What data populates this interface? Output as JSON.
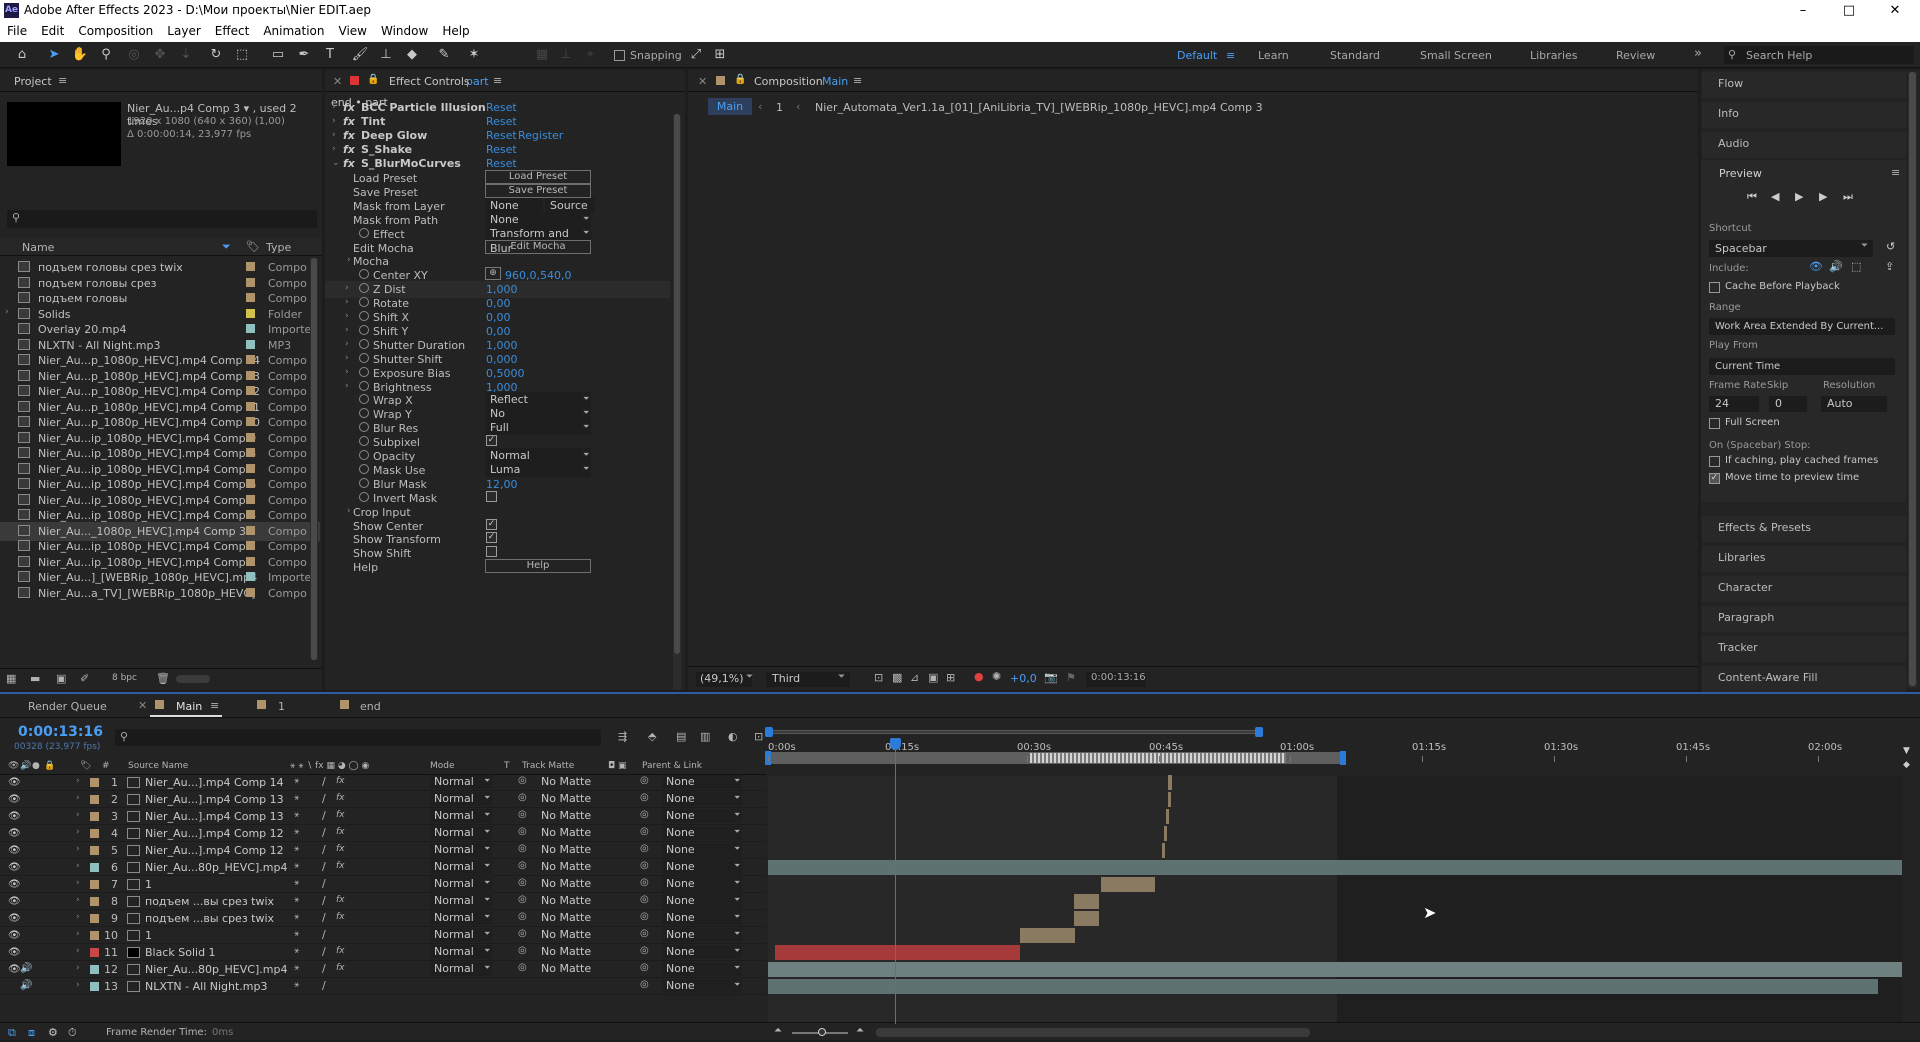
{
  "title_bar": {
    "app_icon": "Ae",
    "title": "Adobe After Effects 2023 - D:\\Мои проекты\\Nier EDIT.aep",
    "min": "–",
    "max": "□",
    "close": "✕"
  },
  "menu": [
    "File",
    "Edit",
    "Composition",
    "Layer",
    "Effect",
    "Animation",
    "View",
    "Window",
    "Help"
  ],
  "toolbar": {
    "snapping_label": "Snapping",
    "workspaces": [
      "Default",
      "Learn",
      "Standard",
      "Small Screen",
      "Libraries",
      "Review"
    ],
    "more": "»",
    "search_placeholder": "Search Help"
  },
  "project": {
    "tab": "Project",
    "preview": {
      "name": "Nier_Au...p4 Comp 3 ▾ , used 2 times",
      "dims": "1920 x 1080  (640 x 360) (1,00)",
      "duration": "Δ 0:00:00:14, 23,977 fps"
    },
    "search_placeholder": "",
    "col_name": "Name",
    "col_type": "Type",
    "items": [
      {
        "name": "подъем головы срез twix",
        "type": "Compo",
        "color": "#b0936b"
      },
      {
        "name": "подъем головы срез",
        "type": "Compo",
        "color": "#b0936b"
      },
      {
        "name": "подъем головы",
        "type": "Compo",
        "color": "#b0936b"
      },
      {
        "name": "Solids",
        "type": "Folder",
        "color": "#d2c24b"
      },
      {
        "name": "Overlay 20.mp4",
        "type": "Importe",
        "color": "#8fbfbf"
      },
      {
        "name": "NLXTN - All Night.mp3",
        "type": "MP3",
        "color": "#8fbfbf"
      },
      {
        "name": "Nier_Au...p_1080p_HEVC].mp4 Comp 14",
        "type": "Compo",
        "color": "#b0936b"
      },
      {
        "name": "Nier_Au...p_1080p_HEVC].mp4 Comp 13",
        "type": "Compo",
        "color": "#b0936b"
      },
      {
        "name": "Nier_Au...p_1080p_HEVC].mp4 Comp 12",
        "type": "Compo",
        "color": "#b0936b"
      },
      {
        "name": "Nier_Au...p_1080p_HEVC].mp4 Comp 11",
        "type": "Compo",
        "color": "#b0936b"
      },
      {
        "name": "Nier_Au...p_1080p_HEVC].mp4 Comp 10",
        "type": "Compo",
        "color": "#b0936b"
      },
      {
        "name": "Nier_Au...ip_1080p_HEVC].mp4 Comp 9",
        "type": "Compo",
        "color": "#b0936b"
      },
      {
        "name": "Nier_Au...ip_1080p_HEVC].mp4 Comp 8",
        "type": "Compo",
        "color": "#b0936b"
      },
      {
        "name": "Nier_Au...ip_1080p_HEVC].mp4 Comp 7",
        "type": "Compo",
        "color": "#b0936b"
      },
      {
        "name": "Nier_Au...ip_1080p_HEVC].mp4 Comp 6",
        "type": "Compo",
        "color": "#b0936b"
      },
      {
        "name": "Nier_Au...ip_1080p_HEVC].mp4 Comp 5",
        "type": "Compo",
        "color": "#b0936b"
      },
      {
        "name": "Nier_Au...ip_1080p_HEVC].mp4 Comp 4",
        "type": "Compo",
        "color": "#b0936b"
      },
      {
        "name": "Nier_Au..._1080p_HEVC].mp4 Comp 3",
        "type": "Compo",
        "color": "#b0936b"
      },
      {
        "name": "Nier_Au...ip_1080p_HEVC].mp4 Comp 2",
        "type": "Compo",
        "color": "#b0936b"
      },
      {
        "name": "Nier_Au...ip_1080p_HEVC].mp4 Comp 1",
        "type": "Compo",
        "color": "#b0936b"
      },
      {
        "name": "Nier_Au...]_[WEBRip_1080p_HEVC].mp4",
        "type": "Importe",
        "color": "#8fbfbf"
      },
      {
        "name": "Nier_Au...a_TV]_[WEBRip_1080p_HEVC]",
        "type": "Compo",
        "color": "#b0936b"
      }
    ],
    "bpc": "8 bpc"
  },
  "effect_controls": {
    "tab": "Effect Controls",
    "tab_layer": "part",
    "breadcrumb": "end • part",
    "effects": [
      {
        "name": "BCC Particle Illusion",
        "reset": "Reset",
        "extra": ""
      },
      {
        "name": "Tint",
        "reset": "Reset",
        "extra": ""
      },
      {
        "name": "Deep Glow",
        "reset": "Reset",
        "extra": "Register"
      },
      {
        "name": "S_Shake",
        "reset": "Reset",
        "extra": ""
      },
      {
        "name": "S_BlurMoCurves",
        "reset": "Reset",
        "extra": ""
      }
    ],
    "params": [
      {
        "label": "Load Preset",
        "kind": "btn",
        "value": "Load Preset"
      },
      {
        "label": "Save Preset",
        "kind": "btn",
        "value": "Save Preset"
      },
      {
        "label": "Mask from Layer",
        "kind": "dd2",
        "value": "None",
        "value2": "Source"
      },
      {
        "label": "Mask from Path",
        "kind": "dd",
        "value": "None"
      },
      {
        "label": "Effect",
        "kind": "dd",
        "value": "Transform and Blur"
      },
      {
        "label": "Edit Mocha",
        "kind": "btn",
        "value": "Edit Mocha"
      },
      {
        "label": "Mocha",
        "kind": "group",
        "value": ""
      },
      {
        "label": "Center XY",
        "kind": "val",
        "value": "960,0,540,0"
      },
      {
        "label": "Z Dist",
        "kind": "val",
        "value": "1,000"
      },
      {
        "label": "Rotate",
        "kind": "val",
        "value": "0,00"
      },
      {
        "label": "Shift X",
        "kind": "val",
        "value": "0,00"
      },
      {
        "label": "Shift Y",
        "kind": "val",
        "value": "0,00"
      },
      {
        "label": "Shutter Duration",
        "kind": "val",
        "value": "1,000"
      },
      {
        "label": "Shutter Shift",
        "kind": "val",
        "value": "0,000"
      },
      {
        "label": "Exposure Bias",
        "kind": "val",
        "value": "0,5000"
      },
      {
        "label": "Brightness",
        "kind": "val",
        "value": "1,000"
      },
      {
        "label": "Wrap X",
        "kind": "dd",
        "value": "Reflect"
      },
      {
        "label": "Wrap Y",
        "kind": "dd",
        "value": "No"
      },
      {
        "label": "Blur Res",
        "kind": "dd",
        "value": "Full"
      },
      {
        "label": "Subpixel",
        "kind": "chk",
        "value": "✓"
      },
      {
        "label": "Opacity",
        "kind": "dd",
        "value": "Normal"
      },
      {
        "label": "Mask Use",
        "kind": "dd",
        "value": "Luma"
      },
      {
        "label": "Blur Mask",
        "kind": "val",
        "value": "12,00"
      },
      {
        "label": "Invert Mask",
        "kind": "chk",
        "value": ""
      },
      {
        "label": "Crop Input",
        "kind": "group",
        "value": ""
      },
      {
        "label": "Show Center",
        "kind": "chk",
        "value": "✓"
      },
      {
        "label": "Show Transform",
        "kind": "chk",
        "value": "✓"
      },
      {
        "label": "Show Shift",
        "kind": "chk",
        "value": ""
      },
      {
        "label": "Help",
        "kind": "btn",
        "value": "Help"
      }
    ]
  },
  "composition": {
    "tab": "Composition",
    "tab_name": "Main",
    "crumb_main": "Main",
    "crumb_num": "1",
    "crumb_path": "Nier_Automata_Ver1.1a_[01]_[AniLibria_TV]_[WEBRip_1080p_HEVC].mp4 Comp 3",
    "zoom": "(49,1%)",
    "resolution": "Third",
    "exposure": "+0,0",
    "timecode": "0:00:13:16"
  },
  "right_panel": {
    "items_top": [
      "Flow",
      "Info",
      "Audio"
    ],
    "preview_title": "Preview",
    "shortcut_label": "Shortcut",
    "shortcut_value": "Spacebar",
    "include_label": "Include:",
    "cache_label": "Cache Before Playback",
    "range_label": "Range",
    "range_value": "Work Area Extended By Current...",
    "play_from_label": "Play From",
    "play_from_value": "Current Time",
    "frame_rate_label": "Frame Rate",
    "skip_label": "Skip",
    "resolution_label": "Resolution",
    "frame_rate_value": "24",
    "skip_value": "0",
    "resolution_value": "Auto",
    "full_screen_label": "Full Screen",
    "stop_label": "On (Spacebar) Stop:",
    "if_caching_label": "If caching, play cached frames",
    "move_time_label": "Move time to preview time",
    "items_bottom": [
      "Effects & Presets",
      "Libraries",
      "Character",
      "Paragraph",
      "Tracker",
      "Content-Aware Fill"
    ]
  },
  "timeline": {
    "tab_render": "Render Queue",
    "tab_main": "Main",
    "tab_1": "1",
    "tab_end": "end",
    "timecode": "0:00:13:16",
    "frames": "00328 (23,977 fps)",
    "col_source": "Source Name",
    "col_mode": "Mode",
    "col_t": "T",
    "col_matte": "Track Matte",
    "col_parent": "Parent & Link",
    "ticks": [
      "0:00s",
      "00:15s",
      "00:30s",
      "00:45s",
      "01:00s",
      "01:15s",
      "01:30s",
      "01:45s",
      "02:00s"
    ],
    "layers": [
      {
        "num": "1",
        "name": "Nier_Au...].mp4 Comp 14",
        "mode": "Normal",
        "matte": "No Matte",
        "parent": "None",
        "color": "#b0936b"
      },
      {
        "num": "2",
        "name": "Nier_Au...].mp4 Comp 13",
        "mode": "Normal",
        "matte": "No Matte",
        "parent": "None",
        "color": "#b0936b"
      },
      {
        "num": "3",
        "name": "Nier_Au...].mp4 Comp 13",
        "mode": "Normal",
        "matte": "No Matte",
        "parent": "None",
        "color": "#b0936b"
      },
      {
        "num": "4",
        "name": "Nier_Au...].mp4 Comp 12",
        "mode": "Normal",
        "matte": "No Matte",
        "parent": "None",
        "color": "#b0936b"
      },
      {
        "num": "5",
        "name": "Nier_Au...].mp4 Comp 12",
        "mode": "Normal",
        "matte": "No Matte",
        "parent": "None",
        "color": "#b0936b"
      },
      {
        "num": "6",
        "name": "Nier_Au...80p_HEVC].mp4",
        "mode": "Normal",
        "matte": "No Matte",
        "parent": "None",
        "color": "#8fbfbf"
      },
      {
        "num": "7",
        "name": "1",
        "mode": "Normal",
        "matte": "No Matte",
        "parent": "None",
        "color": "#b0936b"
      },
      {
        "num": "8",
        "name": "подъем ...вы срез twix",
        "mode": "Normal",
        "matte": "No Matte",
        "parent": "None",
        "color": "#b0936b"
      },
      {
        "num": "9",
        "name": "подъем ...вы срез twix",
        "mode": "Normal",
        "matte": "No Matte",
        "parent": "None",
        "color": "#b0936b"
      },
      {
        "num": "10",
        "name": "1",
        "mode": "Normal",
        "matte": "No Matte",
        "parent": "None",
        "color": "#b0936b"
      },
      {
        "num": "11",
        "name": "Black Solid 1",
        "mode": "Normal",
        "matte": "No Matte",
        "parent": "None",
        "color": "#c84646"
      },
      {
        "num": "12",
        "name": "Nier_Au...80p_HEVC].mp4",
        "mode": "Normal",
        "matte": "No Matte",
        "parent": "None",
        "color": "#8fbfbf"
      },
      {
        "num": "13",
        "name": "NLXTN - All Night.mp3",
        "mode": "",
        "matte": "",
        "parent": "None",
        "color": "#8fbfbf"
      }
    ],
    "frame_render_label": "Frame Render Time:",
    "frame_render_value": "0ms"
  }
}
